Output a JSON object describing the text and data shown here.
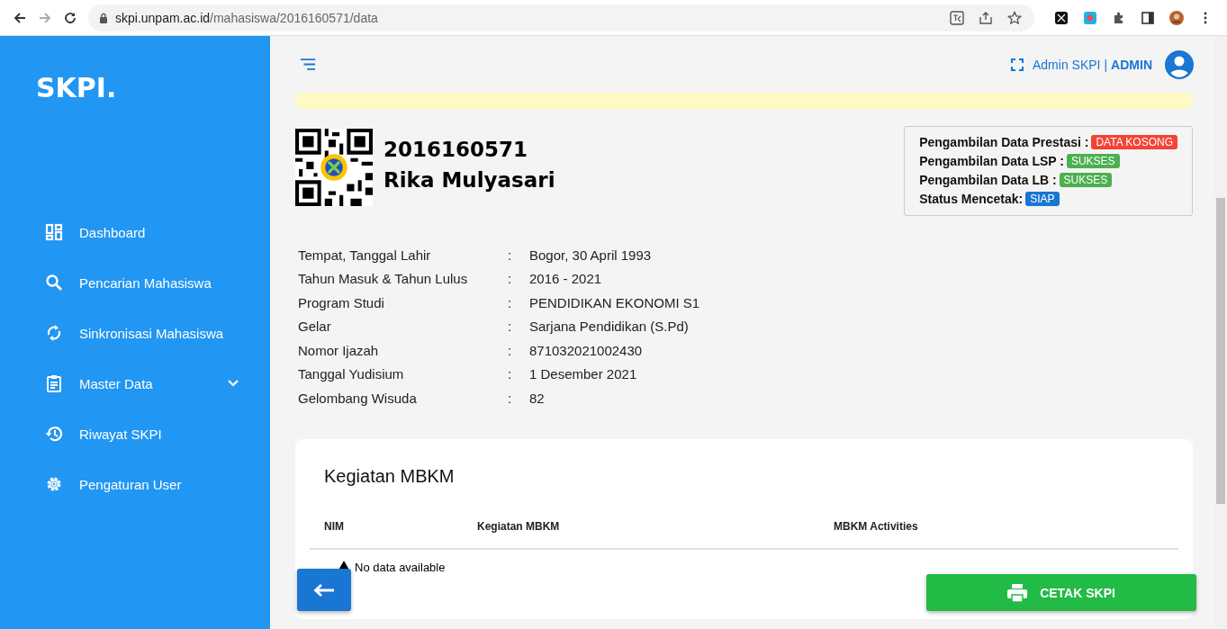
{
  "browser": {
    "url_host": "skpi.unpam.ac.id",
    "url_path": "/mahasiswa/2016160571/data"
  },
  "sidebar": {
    "logo": "SKPI.",
    "items": [
      {
        "label": "Dashboard",
        "kind": "link"
      },
      {
        "label": "Pencarian Mahasiswa",
        "kind": "link"
      },
      {
        "label": "Sinkronisasi Mahasiswa",
        "kind": "link"
      },
      {
        "label": "Master Data",
        "kind": "group",
        "expanded": false
      },
      {
        "label": "Riwayat SKPI",
        "kind": "link"
      },
      {
        "label": "Pengaturan User",
        "kind": "link"
      }
    ]
  },
  "header": {
    "user_name": "Admin SKPI",
    "separator": "|",
    "role": "ADMIN"
  },
  "student": {
    "nim": "2016160571",
    "name": "Rika Mulyasari"
  },
  "statuses": [
    {
      "label": "Pengambilan Data Prestasi :",
      "badge": "DATA KOSONG",
      "color": "#f44336"
    },
    {
      "label": "Pengambilan Data LSP :",
      "badge": "SUKSES",
      "color": "#4caf50"
    },
    {
      "label": "Pengambilan Data LB :",
      "badge": "SUKSES",
      "color": "#4caf50"
    },
    {
      "label": "Status Mencetak:",
      "badge": "SIAP",
      "color": "#1976d2"
    }
  ],
  "details": [
    {
      "label": "Tempat, Tanggal Lahir",
      "value": "Bogor, 30 April 1993"
    },
    {
      "label": "Tahun Masuk & Tahun Lulus",
      "value": "2016 - 2021"
    },
    {
      "label": "Program Studi",
      "value": "PENDIDIKAN EKONOMI S1"
    },
    {
      "label": "Gelar",
      "value": "Sarjana Pendidikan (S.Pd)"
    },
    {
      "label": "Nomor Ijazah",
      "value": "871032021002430"
    },
    {
      "label": "Tanggal Yudisium",
      "value": "1 Desember 2021"
    },
    {
      "label": "Gelombang Wisuda",
      "value": "82"
    }
  ],
  "detail_separator": ":",
  "mbkm": {
    "title": "Kegiatan MBKM",
    "columns": [
      "NIM",
      "Kegiatan MBKM",
      "MBKM Activities"
    ],
    "empty_text": "No data available"
  },
  "print_button": "CETAK SKPI"
}
